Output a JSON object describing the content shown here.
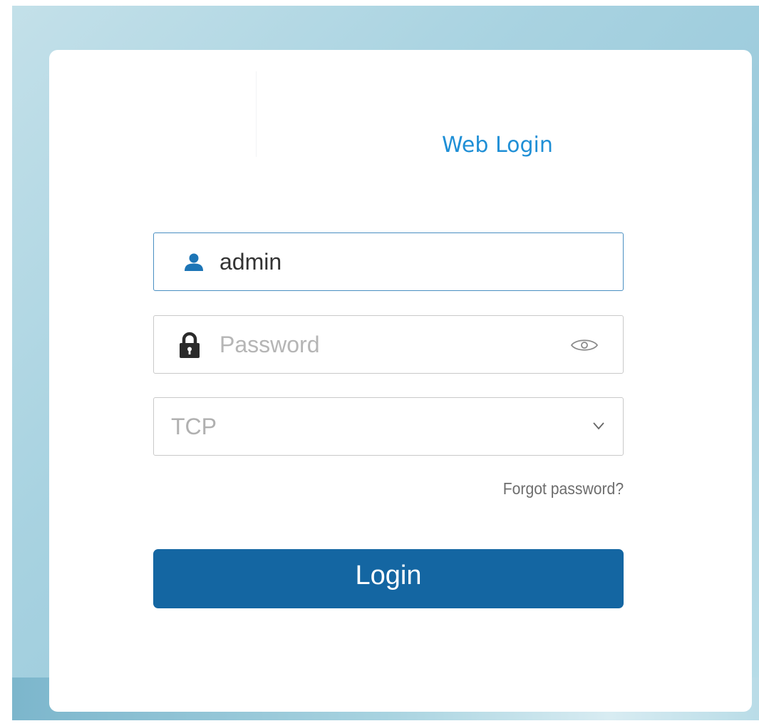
{
  "header": {
    "title": "Web Login"
  },
  "form": {
    "username": {
      "value": "admin",
      "icon": "user-icon"
    },
    "password": {
      "value": "",
      "placeholder": "Password",
      "icon": "lock-icon",
      "toggle_icon": "eye-icon"
    },
    "protocol": {
      "selected": "TCP",
      "icon": "chevron-down-icon"
    },
    "forgot_label": "Forgot password?",
    "login_label": "Login"
  },
  "colors": {
    "accent": "#1f8fd6",
    "button": "#1466a2",
    "focus_border": "#4a8fc2",
    "user_icon": "#1d75b6",
    "lock_icon": "#2b2b2b"
  }
}
